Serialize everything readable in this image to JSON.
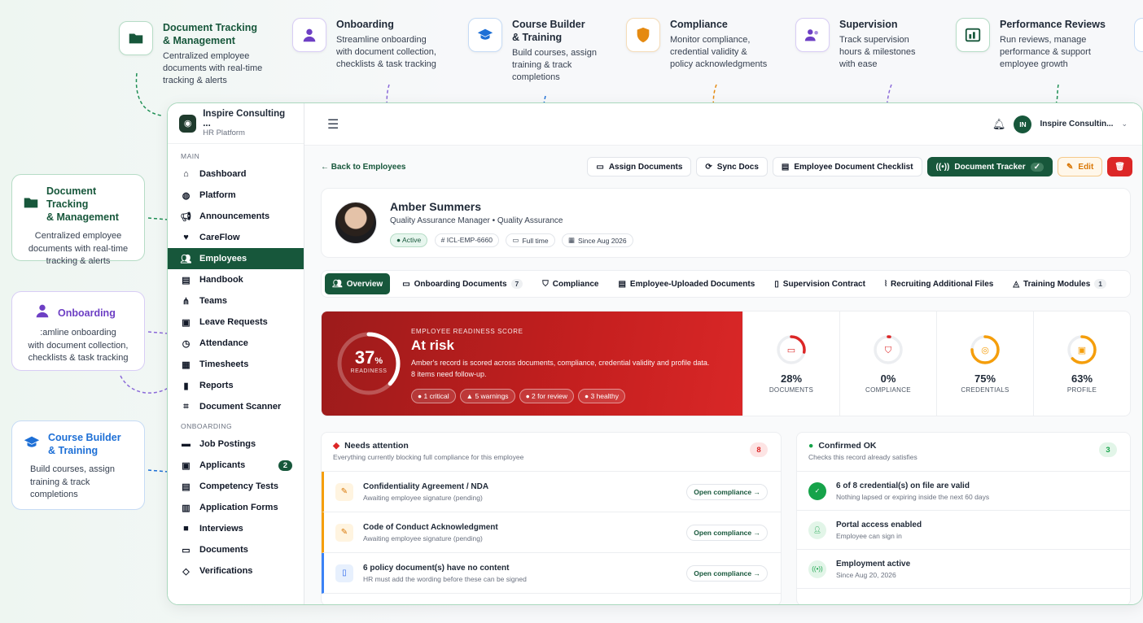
{
  "features": [
    {
      "title1": "Document Tracking",
      "title2": "& Management",
      "desc1": "Centralized employee",
      "desc2": "documents with real-time",
      "desc3": "tracking & alerts"
    },
    {
      "title1": "Onboarding",
      "title2": "",
      "desc1": "Streamline onboarding",
      "desc2": "with document collection,",
      "desc3": "checklists & task tracking"
    },
    {
      "title1": "Course Builder",
      "title2": "& Training",
      "desc1": "Build courses, assign",
      "desc2": "training & track",
      "desc3": "completions"
    },
    {
      "title1": "Compliance",
      "title2": "",
      "desc1": "Monitor compliance,",
      "desc2": "credential validity &",
      "desc3": "policy acknowledgments"
    },
    {
      "title1": "Supervision",
      "title2": "",
      "desc1": "Track supervision",
      "desc2": "hours & milestones",
      "desc3": "with ease"
    },
    {
      "title1": "Performance Reviews",
      "title2": "",
      "desc1": "Run reviews, manage",
      "desc2": "performance & support",
      "desc3": "employee growth"
    }
  ],
  "side_cards": [
    {
      "title1": "Document Tracking",
      "title2": "& Management",
      "desc1": "Centralized employee",
      "desc2": "documents with real-time",
      "desc3": "tracking & alerts"
    },
    {
      "title1": "Onboarding",
      "title2": "",
      "desc1": ":amline onboarding",
      "desc2": "with document collection,",
      "desc3": "checklists & task tracking"
    },
    {
      "title1": "Course Builder",
      "title2": "& Training",
      "desc1": "Build courses, assign",
      "desc2": "training & track",
      "desc3": "completions"
    }
  ],
  "brand": {
    "name": "Inspire Consulting ...",
    "sub": "HR Platform"
  },
  "sidebar": {
    "main_label": "MAIN",
    "main": [
      "Dashboard",
      "Platform",
      "Announcements",
      "CareFlow",
      "Employees",
      "Handbook",
      "Teams",
      "Leave Requests",
      "Attendance",
      "Timesheets",
      "Reports",
      "Document Scanner"
    ],
    "onboarding_label": "ONBOARDING",
    "onboarding": [
      "Job Postings",
      "Applicants",
      "Competency Tests",
      "Application Forms",
      "Interviews",
      "Documents",
      "Verifications"
    ],
    "applicants_badge": "2",
    "icons": [
      "home-icon",
      "chat-icon",
      "megaphone-icon",
      "heart-icon",
      "users-icon",
      "book-icon",
      "team-icon",
      "calendar-icon",
      "clock-icon",
      "timesheet-icon",
      "chart-icon",
      "scan-icon",
      "briefcase-icon",
      "user-file-icon",
      "clipboard-icon",
      "form-icon",
      "video-icon",
      "folder-icon",
      "shield-icon"
    ]
  },
  "topbar": {
    "user_initials": "IN",
    "user_name": "Inspire Consultin..."
  },
  "actions": {
    "back": "← Back to Employees",
    "assign": "Assign Documents",
    "sync": "Sync Docs",
    "checklist": "Employee Document Checklist",
    "tracker": "Document Tracker",
    "edit": "Edit"
  },
  "employee": {
    "name": "Amber Summers",
    "role": "Quality Assurance Manager • Quality Assurance",
    "status": "● Active",
    "id": "# ICL-EMP-6660",
    "type": "Full time",
    "since": "Since Aug 2026"
  },
  "tabs": [
    {
      "label": "Overview",
      "count": ""
    },
    {
      "label": "Onboarding Documents",
      "count": "7"
    },
    {
      "label": "Compliance",
      "count": ""
    },
    {
      "label": "Employee-Uploaded Documents",
      "count": ""
    },
    {
      "label": "Supervision Contract",
      "count": ""
    },
    {
      "label": "Recruiting Additional Files",
      "count": ""
    },
    {
      "label": "Training Modules",
      "count": "1"
    }
  ],
  "readiness": {
    "score": 37,
    "score_text": "37",
    "unit": "%",
    "ring_label": "READINESS",
    "eyebrow": "EMPLOYEE READINESS SCORE",
    "status": "At risk",
    "desc1": "Amber's record is scored across documents, compliance, credential validity and profile data.",
    "desc2": "8 items need follow-up.",
    "pills": [
      "● 1 critical",
      "▲ 5 warnings",
      "● 2 for review",
      "● 3 healthy"
    ]
  },
  "metrics": [
    {
      "value": 28,
      "text": "28%",
      "label": "DOCUMENTS",
      "color": "#dc2626",
      "icon": "folder-icon"
    },
    {
      "value": 0,
      "text": "0%",
      "label": "COMPLIANCE",
      "color": "#dc2626",
      "icon": "shield-icon"
    },
    {
      "value": 75,
      "text": "75%",
      "label": "CREDENTIALS",
      "color": "#f59e0b",
      "icon": "badge-icon"
    },
    {
      "value": 63,
      "text": "63%",
      "label": "PROFILE",
      "color": "#f59e0b",
      "icon": "id-card-icon"
    }
  ],
  "attention": {
    "title": "Needs attention",
    "sub": "Everything currently blocking full compliance for this employee",
    "count": "8",
    "rows": [
      {
        "title": "Confidentiality Agreement / NDA",
        "sub": "Awaiting employee signature (pending)",
        "btn": "Open compliance →"
      },
      {
        "title": "Code of Conduct Acknowledgment",
        "sub": "Awaiting employee signature (pending)",
        "btn": "Open compliance →"
      },
      {
        "title": "6 policy document(s) have no content",
        "sub": "HR must add the wording before these can be signed",
        "btn": "Open compliance →"
      }
    ]
  },
  "confirmed": {
    "title": "Confirmed OK",
    "sub": "Checks this record already satisfies",
    "count": "3",
    "rows": [
      {
        "title": "6 of 8 credential(s) on file are valid",
        "sub": "Nothing lapsed or expiring inside the next 60 days"
      },
      {
        "title": "Portal access enabled",
        "sub": "Employee can sign in"
      },
      {
        "title": "Employment active",
        "sub": "Since Aug 20, 2026"
      }
    ]
  },
  "colors": {
    "brand_green": "#17573b",
    "risk_red": "#c41f1f",
    "warning": "#f59e0b"
  }
}
